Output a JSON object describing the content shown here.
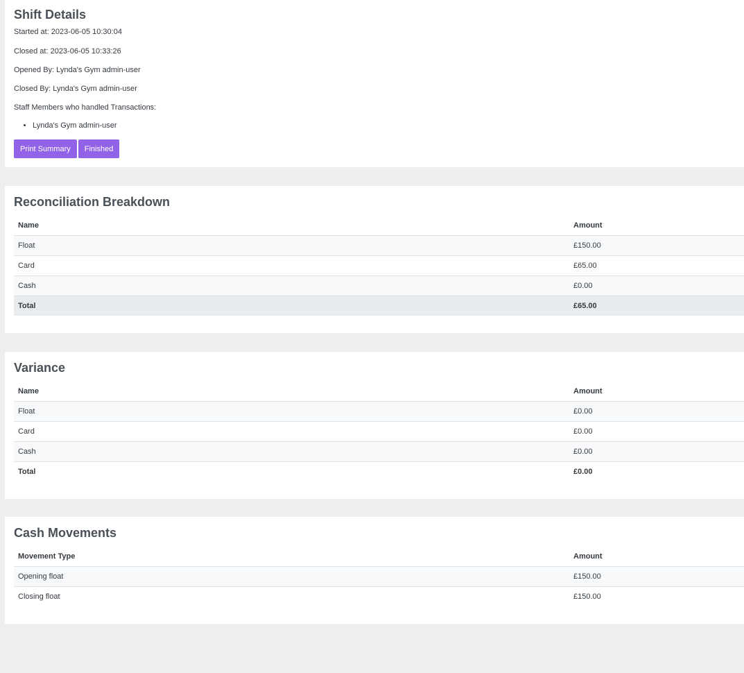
{
  "shift": {
    "title": "Shift Details",
    "started": "Started at: 2023-06-05 10:30:04",
    "closed": "Closed at: 2023-06-05 10:33:26",
    "opened_by": "Opened By: Lynda's Gym admin-user",
    "closed_by": "Closed By: Lynda's Gym admin-user",
    "staff_heading": "Staff Members who handled Transactions:",
    "staff": [
      "Lynda's Gym admin-user"
    ],
    "print_label": "Print Summary",
    "finished_label": "Finished",
    "button_color": "#9263e8"
  },
  "reconciliation": {
    "title": "Reconciliation Breakdown",
    "headers": [
      "Name",
      "Amount"
    ],
    "rows": [
      {
        "name": "Float",
        "amount": "£150.00"
      },
      {
        "name": "Card",
        "amount": "£65.00"
      },
      {
        "name": "Cash",
        "amount": "£0.00"
      }
    ],
    "total": {
      "name": "Total",
      "amount": "£65.00"
    }
  },
  "variance": {
    "title": "Variance",
    "headers": [
      "Name",
      "Amount"
    ],
    "rows": [
      {
        "name": "Float",
        "amount": "£0.00"
      },
      {
        "name": "Card",
        "amount": "£0.00"
      },
      {
        "name": "Cash",
        "amount": "£0.00"
      }
    ],
    "total": {
      "name": "Total",
      "amount": "£0.00"
    }
  },
  "cash_movements": {
    "title": "Cash Movements",
    "headers": [
      "Movement Type",
      "Amount"
    ],
    "rows": [
      {
        "name": "Opening float",
        "amount": "£150.00"
      },
      {
        "name": "Closing float",
        "amount": "£150.00"
      }
    ]
  }
}
